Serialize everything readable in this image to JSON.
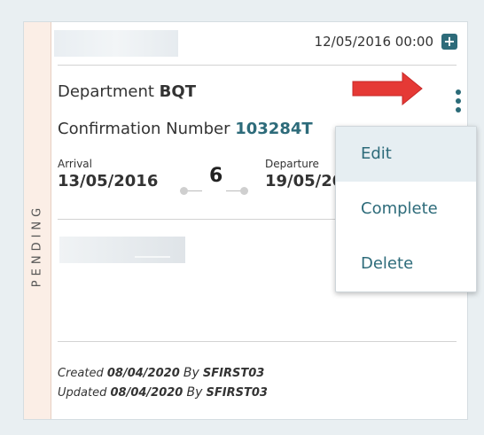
{
  "card": {
    "status": "PENDING",
    "datetime": "12/05/2016 00:00",
    "department_label": "Department",
    "department_code": "BQT",
    "confirmation_label": "Confirmation Number",
    "confirmation_number": "103284T",
    "arrival_label": "Arrival",
    "arrival_date": "13/05/2016",
    "nights": "6",
    "departure_label": "Departure",
    "departure_date": "19/05/2016",
    "created_label": "Created",
    "created_date": "08/04/2020",
    "created_by_label": "By",
    "created_by": "SFIRST03",
    "updated_label": "Updated",
    "updated_date": "08/04/2020",
    "updated_by_label": "By",
    "updated_by": "SFIRST03",
    "add_icon": "+"
  },
  "menu": {
    "items": [
      {
        "label": "Edit"
      },
      {
        "label": "Complete"
      },
      {
        "label": "Delete"
      }
    ]
  },
  "colors": {
    "accent": "#2d6b7a",
    "status_strip": "#fbeee6",
    "arrow": "#e53935",
    "menu_hover": "#e6eef2"
  },
  "icons": {
    "add": "plus-square-icon",
    "more": "kebab-menu-icon",
    "annotation": "red-arrow-icon"
  }
}
